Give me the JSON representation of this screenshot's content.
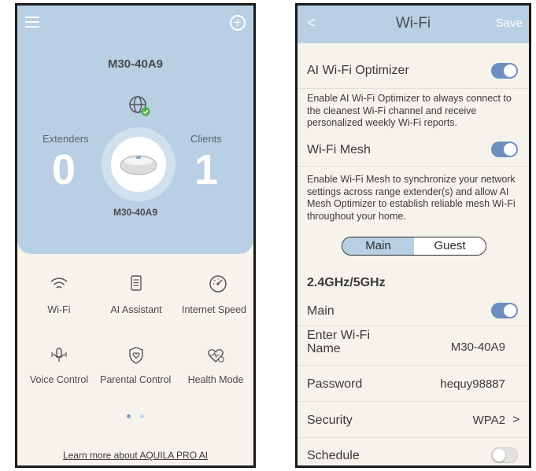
{
  "left": {
    "device_name": "M30-40A9",
    "extenders": {
      "label": "Extenders",
      "count": "0"
    },
    "clients": {
      "label": "Clients",
      "count": "1"
    },
    "router_label": "M30-40A9",
    "tiles": [
      {
        "label": "Wi-Fi",
        "icon": "wifi-icon"
      },
      {
        "label": "AI Assistant",
        "icon": "document-icon"
      },
      {
        "label": "Internet Speed",
        "icon": "speedometer-icon"
      },
      {
        "label": "Voice Control",
        "icon": "microphone-icon"
      },
      {
        "label": "Parental Control",
        "icon": "shield-heart-icon"
      },
      {
        "label": "Health Mode",
        "icon": "heart-pulse-icon"
      }
    ],
    "learn_more": "Learn more about AQUILA PRO AI",
    "colors": {
      "accent": "#b9cfe4",
      "background": "#f6f3ec"
    }
  },
  "right": {
    "header": {
      "back": "<",
      "title": "Wi-Fi",
      "save": "Save"
    },
    "ai_optimizer": {
      "label": "AI Wi-Fi Optimizer",
      "enabled": true,
      "description": "Enable AI Wi-Fi Optimizer to always connect to the cleanest Wi-Fi channel and receive personalized weekly Wi-Fi reports."
    },
    "mesh": {
      "label": "Wi-Fi Mesh",
      "enabled": true,
      "description": "Enable Wi-Fi Mesh to synchronize your network settings across range extender(s) and allow AI Mesh Optimizer to establish reliable mesh Wi-Fi throughout your home."
    },
    "segment": {
      "main": "Main",
      "guest": "Guest",
      "selected": "Main"
    },
    "band_title": "2.4GHz/5GHz",
    "main_toggle": {
      "label": "Main",
      "enabled": true
    },
    "name_field": {
      "label": "Enter Wi-Fi Name",
      "value": "M30-40A9"
    },
    "password": {
      "label": "Password",
      "value": "hequy98887"
    },
    "security": {
      "label": "Security",
      "value": "WPA2",
      "chevron": ">"
    },
    "schedule": {
      "label": "Schedule",
      "enabled": false
    },
    "colors": {
      "toggle_on": "#6d8fbf",
      "toggle_off": "#e4e2de"
    }
  }
}
